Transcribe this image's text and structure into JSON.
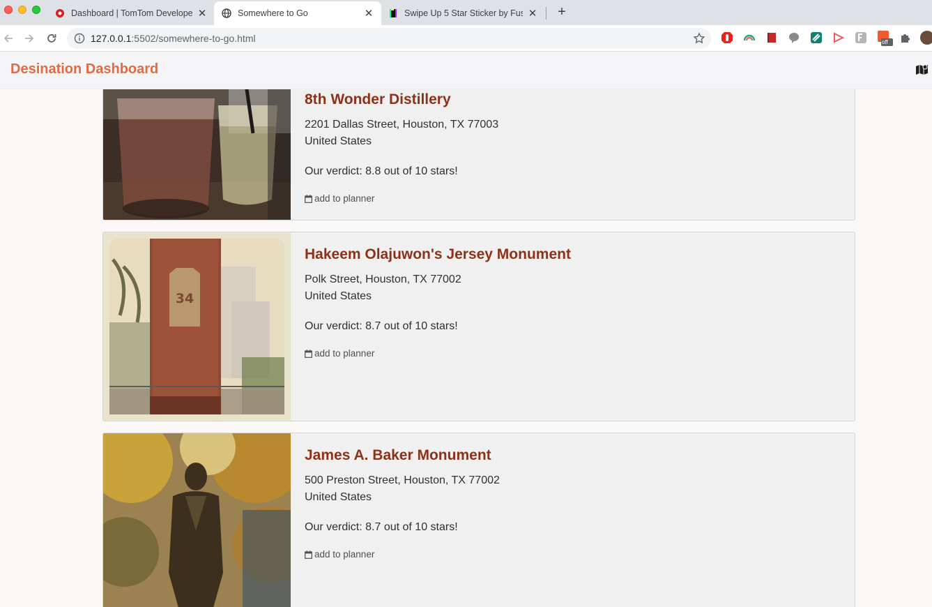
{
  "browser": {
    "tabs": [
      {
        "title": "Dashboard | TomTom Develope",
        "favicon": "tomtom-icon",
        "active": false
      },
      {
        "title": "Somewhere to Go",
        "favicon": "globe-icon",
        "active": true
      },
      {
        "title": "Swipe Up 5 Star Sticker by Fus",
        "favicon": "giphy-icon",
        "active": false
      }
    ],
    "close_glyph": "✕",
    "new_tab_glyph": "+",
    "url_host": "127.0.0.1",
    "url_rest": ":5502/somewhere-to-go.html",
    "extension_badge": "off"
  },
  "app": {
    "brand": "Desination Dashboard",
    "brand_color": "#e16a40",
    "title_color": "#8b3218"
  },
  "places": [
    {
      "name": "8th Wonder Distillery",
      "address_line1": "2201 Dallas Street, Houston, TX 77003",
      "address_line2": "United States",
      "verdict": "Our verdict: 8.8 out of 10 stars!",
      "planner_label": "add to planner",
      "photo": "cocktail-glasses-photo"
    },
    {
      "name": "Hakeem Olajuwon's Jersey Monument",
      "address_line1": "Polk Street, Houston, TX 77002",
      "address_line2": "United States",
      "verdict": "Our verdict: 8.7 out of 10 stars!",
      "planner_label": "add to planner",
      "photo": "jersey-monument-photo",
      "photo_jersey_number": "34"
    },
    {
      "name": "James A. Baker Monument",
      "address_line1": "500 Preston Street, Houston, TX 77002",
      "address_line2": "United States",
      "verdict": "Our verdict: 8.7 out of 10 stars!",
      "planner_label": "add to planner",
      "photo": "bronze-statue-photo"
    }
  ]
}
